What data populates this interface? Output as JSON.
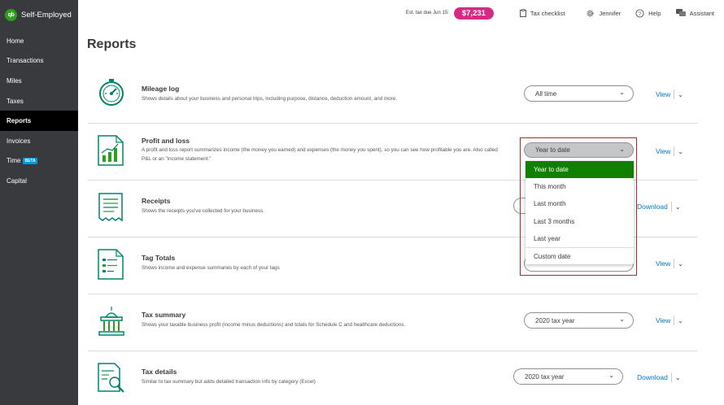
{
  "brand": {
    "logo_text": "qb",
    "name": "Self-Employed"
  },
  "sidebar": {
    "items": [
      {
        "label": "Home"
      },
      {
        "label": "Transactions"
      },
      {
        "label": "Miles"
      },
      {
        "label": "Taxes"
      },
      {
        "label": "Reports",
        "active": true
      },
      {
        "label": "Invoices"
      },
      {
        "label": "Time",
        "badge": "BETA"
      },
      {
        "label": "Capital"
      }
    ]
  },
  "topbar": {
    "est_tax_label": "Est. tax due Jun 15:",
    "est_tax_amount": "$7,231",
    "tax_checklist": "Tax checklist",
    "user": "Jennifer",
    "help": "Help",
    "assistant": "Assistant"
  },
  "page": {
    "title": "Reports"
  },
  "reports": [
    {
      "title": "Mileage log",
      "desc": "Shows details about your business and personal trips, including purpose, distance, deduction amount, and more.",
      "select": "All time",
      "action": "View",
      "icon": "speedometer-icon"
    },
    {
      "title": "Profit and loss",
      "desc": "A profit and loss report summarizes income (the money you earned) and expenses (the money you spent), so you can see how profitable you are. Also called P&L or an \"income statement.\"",
      "select": "Year to date",
      "action": "View",
      "icon": "chart-document-icon"
    },
    {
      "title": "Receipts",
      "desc": "Shows the receipts you've collected for your business.",
      "select": "",
      "action": "Download",
      "icon": "receipt-icon"
    },
    {
      "title": "Tag Totals",
      "desc": "Shows income and expense summaries by each of your tags",
      "select": "",
      "action": "View",
      "icon": "tag-document-icon"
    },
    {
      "title": "Tax summary",
      "desc": "Shows your taxable business profit (income minus deductions) and totals for Schedule C and healthcare deductions.",
      "select": "2020 tax year",
      "action": "View",
      "icon": "capitol-building-icon"
    },
    {
      "title": "Tax details",
      "desc": "Similar to tax summary but adds detailed transaction info by category (Excel)",
      "select": "2020 tax year",
      "action": "Download",
      "icon": "magnifier-document-icon"
    }
  ],
  "dropdown": {
    "current": "Year to date",
    "options": [
      "Year to date",
      "This month",
      "Last month",
      "Last 3 months",
      "Last year",
      "Custom date"
    ]
  },
  "colors": {
    "accent_green": "#108000",
    "link_blue": "#0077c5",
    "badge_pink": "#d52b84",
    "sidebar_bg": "#393a3d",
    "icon_teal": "#00836b"
  }
}
